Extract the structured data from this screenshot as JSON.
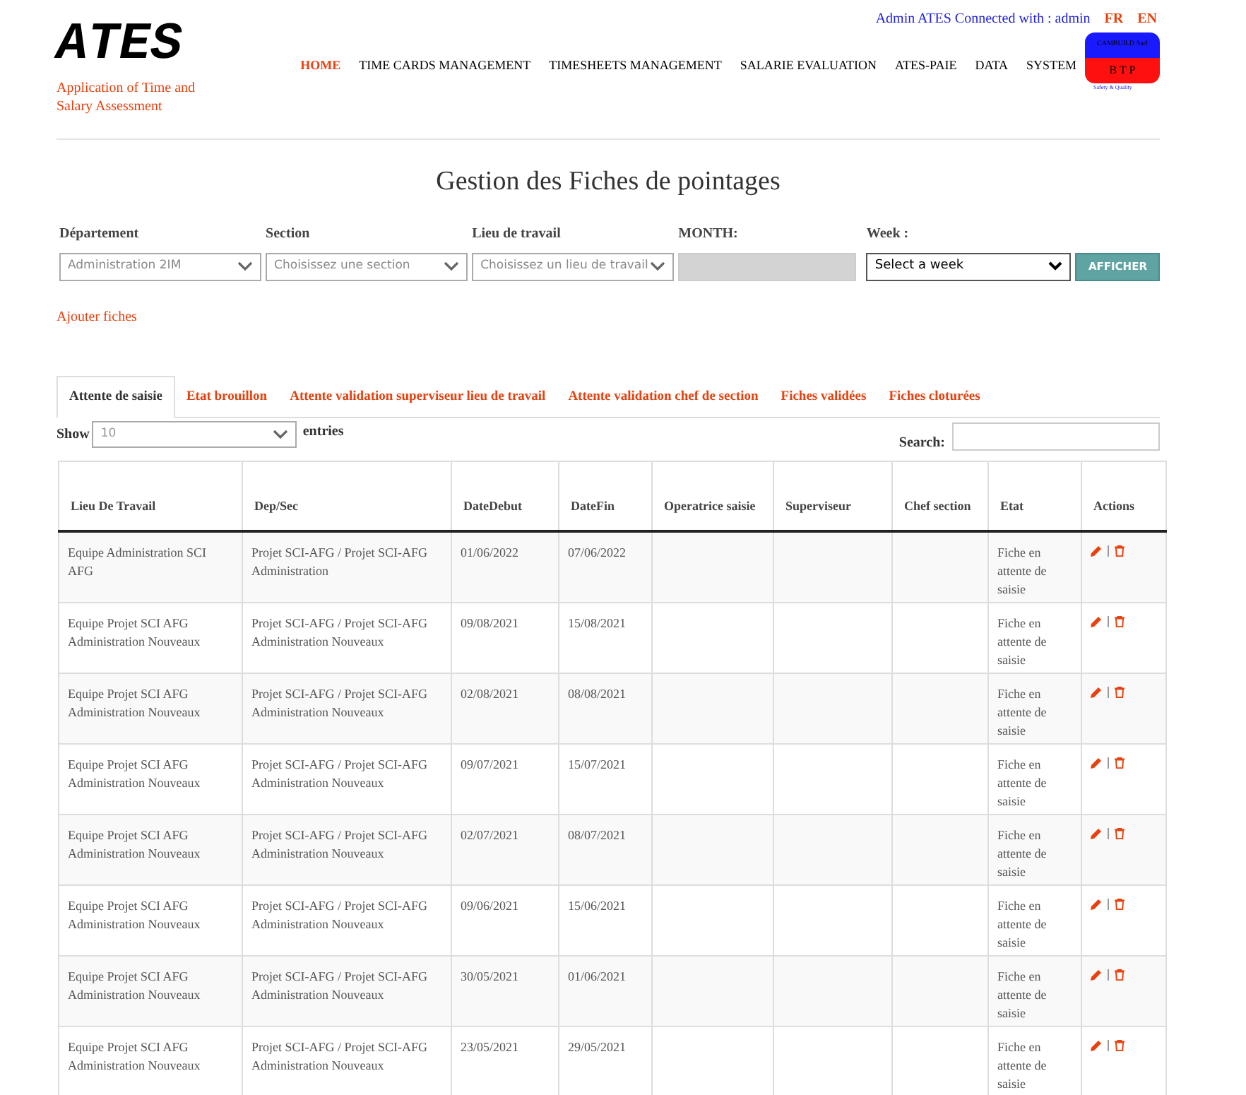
{
  "header": {
    "logo": "ATES",
    "tagline": "Application of Time and Salary Assessment",
    "user_info": "Admin ATES Connected with : admin",
    "languages": [
      "FR",
      "EN"
    ],
    "nav": [
      {
        "label": "HOME",
        "selected": true
      },
      {
        "label": "TIME CARDS MANAGEMENT",
        "selected": false
      },
      {
        "label": "TIMESHEETS MANAGEMENT",
        "selected": false
      },
      {
        "label": "SALARIE EVALUATION",
        "selected": false
      },
      {
        "label": "ATES-PAIE",
        "selected": false
      },
      {
        "label": "DATA",
        "selected": false
      },
      {
        "label": "SYSTEM",
        "selected": false
      }
    ],
    "company_logo": {
      "name": "CAMBUILD Sarl",
      "sub": "B T P",
      "caption": "Safety & Quality"
    }
  },
  "page_title": "Gestion des Fiches de pointages",
  "filters": [
    {
      "kind": "select",
      "label": "Département",
      "value": "Administration 2IM"
    },
    {
      "kind": "select",
      "label": "Section",
      "value": "Choisissez une section"
    },
    {
      "kind": "select",
      "label": "Lieu de travail",
      "value": "Choisissez un lieu de travail"
    },
    {
      "kind": "month",
      "label": "MONTH:"
    },
    {
      "kind": "week",
      "label": "Week :",
      "value": "Select a week"
    }
  ],
  "submit_button": "AFFICHER",
  "add_link": "Ajouter fiches",
  "tabs": [
    {
      "label": "Attente de saisie",
      "selected": true
    },
    {
      "label": "Etat brouillon",
      "selected": false
    },
    {
      "label": "Attente validation superviseur lieu de travail",
      "selected": false
    },
    {
      "label": "Attente validation chef de section",
      "selected": false
    },
    {
      "label": "Fiches validées",
      "selected": false
    },
    {
      "label": "Fiches cloturées",
      "selected": false
    }
  ],
  "table_controls": {
    "show_label": "Show",
    "page_size": "10",
    "entries_label": "entries",
    "search_label": "Search:"
  },
  "table": {
    "columns": [
      "Lieu De Travail",
      "Dep/Sec",
      "DateDebut",
      "DateFin",
      "Operatrice saisie",
      "Superviseur",
      "Chef section",
      "Etat",
      "Actions"
    ],
    "rows": [
      {
        "lieu": "Equipe Administration SCI AFG",
        "depsec": "Projet SCI-AFG / Projet SCI-AFG Administration",
        "debut": "01/06/2022",
        "fin": "07/06/2022",
        "etat": "Fiche en attente de saisie"
      },
      {
        "lieu": "Equipe Projet SCI AFG Administration Nouveaux",
        "depsec": "Projet SCI-AFG / Projet SCI-AFG Administration Nouveaux",
        "debut": "09/08/2021",
        "fin": "15/08/2021",
        "etat": "Fiche en attente de saisie"
      },
      {
        "lieu": "Equipe Projet SCI AFG Administration Nouveaux",
        "depsec": "Projet SCI-AFG / Projet SCI-AFG Administration Nouveaux",
        "debut": "02/08/2021",
        "fin": "08/08/2021",
        "etat": "Fiche en attente de saisie"
      },
      {
        "lieu": "Equipe Projet SCI AFG Administration Nouveaux",
        "depsec": "Projet SCI-AFG / Projet SCI-AFG Administration Nouveaux",
        "debut": "09/07/2021",
        "fin": "15/07/2021",
        "etat": "Fiche en attente de saisie"
      },
      {
        "lieu": "Equipe Projet SCI AFG Administration Nouveaux",
        "depsec": "Projet SCI-AFG / Projet SCI-AFG Administration Nouveaux",
        "debut": "02/07/2021",
        "fin": "08/07/2021",
        "etat": "Fiche en attente de saisie"
      },
      {
        "lieu": "Equipe Projet SCI AFG Administration Nouveaux",
        "depsec": "Projet SCI-AFG / Projet SCI-AFG Administration Nouveaux",
        "debut": "09/06/2021",
        "fin": "15/06/2021",
        "etat": "Fiche en attente de saisie"
      },
      {
        "lieu": "Equipe Projet SCI AFG Administration Nouveaux",
        "depsec": "Projet SCI-AFG / Projet SCI-AFG Administration Nouveaux",
        "debut": "30/05/2021",
        "fin": "01/06/2021",
        "etat": "Fiche en attente de saisie"
      },
      {
        "lieu": "Equipe Projet SCI AFG Administration Nouveaux",
        "depsec": "Projet SCI-AFG / Projet SCI-AFG Administration Nouveaux",
        "debut": "23/05/2021",
        "fin": "29/05/2021",
        "etat": "Fiche en attente de saisie"
      }
    ]
  }
}
